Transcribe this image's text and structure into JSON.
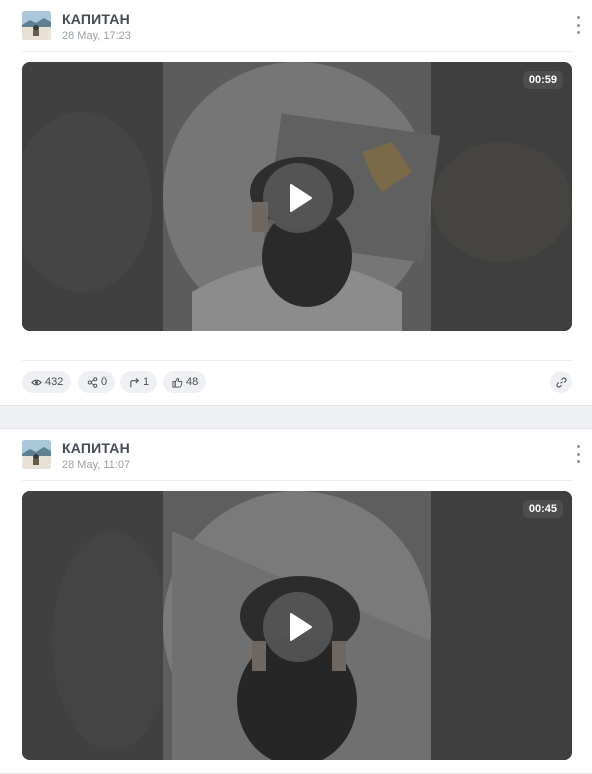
{
  "posts": [
    {
      "author": "КАПИТАН",
      "date": "28 May, 17:23",
      "duration": "00:59",
      "stats": {
        "views": "432",
        "shares": "0",
        "reposts": "1",
        "likes": "48"
      }
    },
    {
      "author": "КАПИТАН",
      "date": "28 May, 11:07",
      "duration": "00:45"
    }
  ],
  "icons": {
    "views": "eye-icon",
    "shares": "share-nodes-icon",
    "reposts": "repost-arrow-icon",
    "likes": "thumbs-up-icon",
    "link": "link-icon",
    "menu": "more-vertical-icon",
    "play": "play-icon"
  },
  "colors": {
    "accent_bg": "#eef0f3",
    "text_muted": "#9aa0a6",
    "name": "#444b52"
  }
}
